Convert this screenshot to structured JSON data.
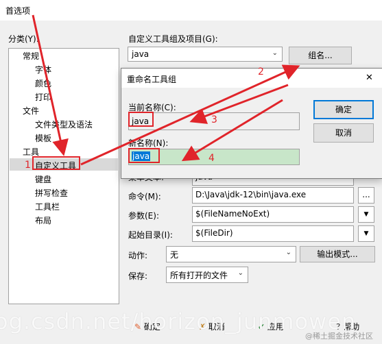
{
  "window": {
    "title": "首选项"
  },
  "sidebar": {
    "heading": "分类(Y):",
    "items": [
      "常规",
      "字体",
      "颜色",
      "打印",
      "文件",
      "文件类型及语法",
      "模板",
      "工具",
      "自定义工具",
      "键盘",
      "拼写检查",
      "工具栏",
      "布局"
    ],
    "selected": "自定义工具"
  },
  "main": {
    "group_label": "自定义工具组及项目(G):",
    "group_value": "java",
    "rename_button": "组名...",
    "menu_text_label": "菜单文本:",
    "menu_text_value": "java",
    "command_label": "命令(M):",
    "command_value": "D:\\Java\\jdk-12\\bin\\java.exe",
    "browse_button": "...",
    "params_label": "参数(E):",
    "params_value": "$(FileNameNoExt)",
    "startdir_label": "起始目录(I):",
    "startdir_value": "$(FileDir)",
    "action_label": "动作:",
    "action_value": "无",
    "output_button": "输出模式...",
    "save_label": "保存:",
    "save_value": "所有打开的文件"
  },
  "dialog": {
    "title": "重命名工具组",
    "close_glyph": "✕",
    "current_label": "当前名称(C):",
    "current_value": "java",
    "new_label": "新名称(N):",
    "new_value": "java",
    "ok": "确定",
    "cancel": "取消"
  },
  "bottom": {
    "ok": "确定",
    "cancel": "取消",
    "apply": "应用",
    "help": "帮助"
  },
  "annotations": [
    "1",
    "2",
    "3",
    "4"
  ],
  "watermark": "og.csdn.net/horizon_junmowen",
  "credit": "@稀土掘金技术社区",
  "colors": {
    "annotation": "#e0242a",
    "selection": "#0078d7",
    "new_field_bg": "#c8e6c9"
  }
}
